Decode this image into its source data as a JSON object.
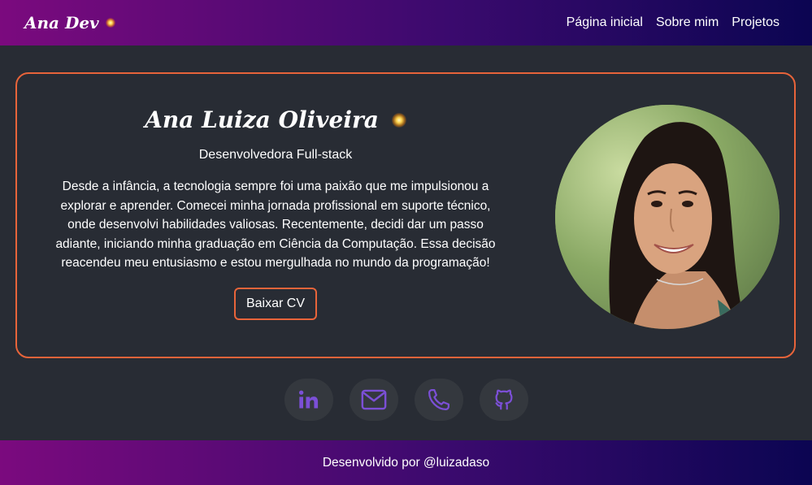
{
  "nav": {
    "brand": "Ana Dev",
    "links": [
      "Página inicial",
      "Sobre mim",
      "Projetos"
    ]
  },
  "profile": {
    "name": "Ana Luiza Oliveira",
    "role": "Desenvolvedora Full-stack",
    "bio": "Desde a infância, a tecnologia sempre foi uma paixão que me impulsionou a explorar e aprender. Comecei minha jornada profissional em suporte técnico, onde desenvolvi habilidades valiosas. Recentemente, decidi dar um passo adiante, iniciando minha graduação em Ciência da Computação. Essa decisão reacendeu meu entusiasmo e estou mergulhada no mundo da programação!",
    "cv_button": "Baixar CV"
  },
  "social": {
    "icons": [
      "linkedin-icon",
      "mail-icon",
      "phone-icon",
      "github-icon"
    ]
  },
  "footer": {
    "text": "Desenvolvido por @luizadaso"
  },
  "colors": {
    "accent": "#e8643a",
    "icon": "#7b4fd6",
    "background": "#282c34",
    "gradient_start": "#7b0a7e",
    "gradient_end": "#0b0552"
  }
}
